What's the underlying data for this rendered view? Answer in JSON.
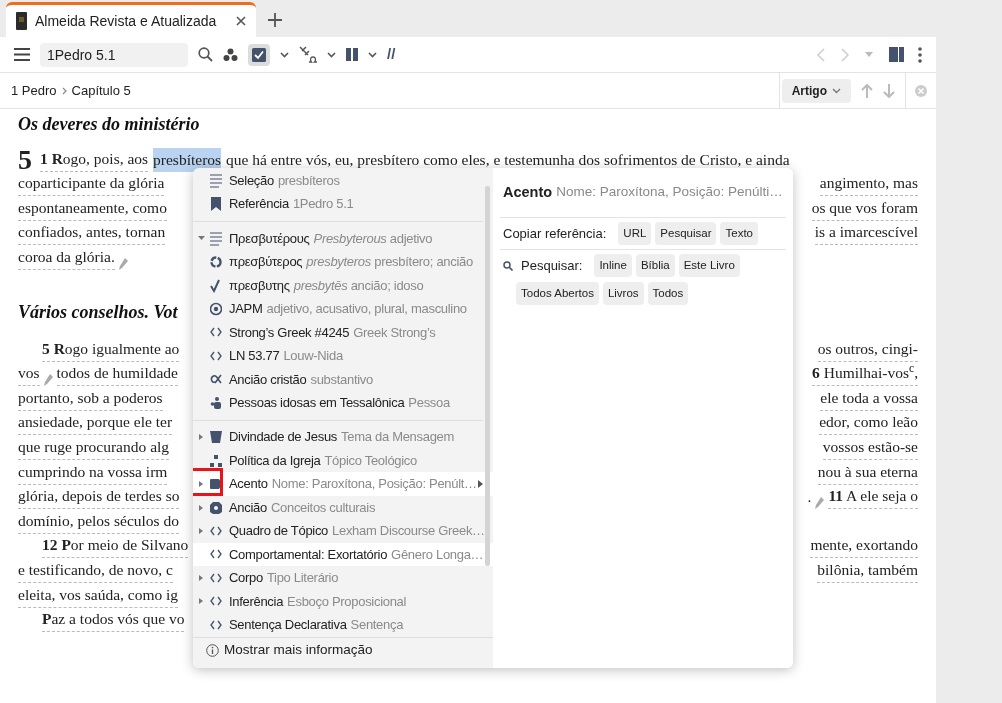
{
  "tabs": [
    {
      "title": "Almeida Revista e Atualizada",
      "selected": true
    }
  ],
  "toolbar": {
    "reference": "1Pedro 5.1",
    "parallel_mark": "//",
    "toggle_on": true
  },
  "breadcrumb": [
    "1 Pedro",
    "Capítulo 5"
  ],
  "article_button": "Artigo",
  "text": [
    {
      "kind": "heading",
      "left": "Os deveres do ministério"
    },
    {
      "kind": "line",
      "chapter": "5",
      "left": "**1** **R**ogo, pois, aos",
      "selected_text": "presbíteros",
      "rest": "que há entre vós, eu, presbítero como eles, e testemunha dos sofrimentos de Cristo, e ainda"
    },
    {
      "kind": "line",
      "left": "coparticipante da glória",
      "right": "angimento, mas"
    },
    {
      "kind": "line",
      "left": "espontaneamente, como",
      "right": "os que vos foram"
    },
    {
      "kind": "line",
      "left": "confiados, antes, tornan",
      "right": "is a imarcescível"
    },
    {
      "kind": "line",
      "left": "coroa da glória.",
      "note": true
    },
    {
      "kind": "heading",
      "left": "Vários conselhos. Vot"
    },
    {
      "kind": "line",
      "indent": true,
      "left": "**5** **R**ogo igualmente ao",
      "right": "os outros, cingi-"
    },
    {
      "kind": "line",
      "left": "vos",
      "note": true,
      "left2": "todos de humildade",
      "right": "**6** Humilhai-vos$^{c}$,"
    },
    {
      "kind": "line",
      "left": "portanto, sob a poderos",
      "right": "ele toda a vossa"
    },
    {
      "kind": "line",
      "left": "ansiedade, porque ele ter",
      "right": "edor, como leão"
    },
    {
      "kind": "line",
      "left": "que ruge procurando alg",
      "right": "vossos estão-se"
    },
    {
      "kind": "line",
      "left": "cumprindo na vossa irm",
      "right": "nou à sua eterna"
    },
    {
      "kind": "line",
      "left": "glória, depois de terdes so",
      "right_prefix": ".",
      "right_note": true,
      "right": "**11** A ele seja o"
    },
    {
      "kind": "line",
      "left": "domínio, pelos séculos do"
    },
    {
      "kind": "line",
      "indent": true,
      "left": "**12** **P**or meio de Silvano",
      "right": "mente, exortando"
    },
    {
      "kind": "line",
      "left": "e testificando, de novo, c",
      "right": "bilônia, também"
    },
    {
      "kind": "line",
      "left": "eleita, vos saúda, como ig"
    },
    {
      "kind": "line",
      "indent": true,
      "left": "**P**az a todos vós que vo"
    }
  ],
  "popup": {
    "menu": [
      {
        "kind": "selection",
        "label": "Seleção",
        "detail": "presbíteros",
        "expandable": false,
        "hovered": false
      },
      {
        "kind": "reference",
        "label": "Referência",
        "detail": "1Pedro 5.1",
        "expandable": false,
        "hovered": false
      },
      {
        "kind": "divider"
      },
      {
        "kind": "selection",
        "label": "Πρεσβυτέρους",
        "detail": "*Presbyterous* adjetivo",
        "expandable": true,
        "expanded": true,
        "hovered": false
      },
      {
        "kind": "lemma",
        "label": "πρεσβύτερος",
        "detail": "*presbyteros* presbítero; ancião",
        "expandable": false,
        "hovered": false
      },
      {
        "kind": "root",
        "label": "πρεσβυτης",
        "detail": "*presbytēs* ancião; idoso",
        "expandable": false,
        "hovered": false
      },
      {
        "kind": "morphology",
        "label": "JAPM",
        "detail": "adjetivo, acusativo, plural, masculino",
        "expandable": false,
        "hovered": false
      },
      {
        "kind": "dataset",
        "label": "Strong’s Greek #4245",
        "detail": "Greek Strong’s",
        "expandable": false,
        "hovered": false
      },
      {
        "kind": "dataset",
        "label": "LN 53.77",
        "detail": "Louw-Nida",
        "expandable": false,
        "hovered": false
      },
      {
        "kind": "sense",
        "label": "Ancião cristão",
        "detail": "substantivo",
        "expandable": false,
        "hovered": false
      },
      {
        "kind": "person",
        "label": "Pessoas idosas em Tessalônica",
        "detail": "Pessoa",
        "expandable": false,
        "hovered": false
      },
      {
        "kind": "divider"
      },
      {
        "kind": "theme",
        "label": "Divindade de Jesus",
        "detail": "Tema da Mensagem",
        "expandable": true,
        "expanded": false,
        "hovered": false
      },
      {
        "kind": "topic",
        "label": "Política da Igreja",
        "detail": "Tópico Teológico",
        "expandable": false,
        "hovered": false
      },
      {
        "kind": "label",
        "label": "Acento",
        "detail": "Nome: Paroxítona, Posição: Penúlt…",
        "expandable": true,
        "expanded": false,
        "hovered": true,
        "submenu": true,
        "highlighted": true
      },
      {
        "kind": "culture",
        "label": "Ancião",
        "detail": "Conceitos culturais",
        "expandable": true,
        "expanded": false,
        "hovered": false
      },
      {
        "kind": "dataset",
        "label": "Quadro de Tópico",
        "detail": "Lexham Discourse Greek…",
        "expandable": true,
        "expanded": false,
        "hovered": false
      },
      {
        "kind": "dataset",
        "label": "Comportamental: Exortatório",
        "detail": "Gênero Longa…",
        "expandable": false,
        "hovered": true
      },
      {
        "kind": "dataset",
        "label": "Corpo",
        "detail": "Tipo Literário",
        "expandable": true,
        "expanded": false,
        "hovered": false
      },
      {
        "kind": "dataset",
        "label": "Inferência",
        "detail": "Esboço Proposicional",
        "expandable": true,
        "expanded": false,
        "hovered": false
      },
      {
        "kind": "dataset",
        "label": "Sentença Declarativa",
        "detail": "Sentença",
        "expandable": false,
        "hovered": false
      }
    ],
    "footer": "Mostrar mais informação",
    "panel": {
      "title": "Acento",
      "subtitle": "Nome: Paroxítona, Posição: Penúlti…",
      "copy_label": "Copiar referência:",
      "copy_buttons": [
        "URL",
        "Pesquisar",
        "Texto"
      ],
      "search_label": "Pesquisar:",
      "search_buttons": [
        "Inline",
        "Bíblia",
        "Este Livro",
        "Todos Abertos",
        "Livros",
        "Todos"
      ]
    }
  }
}
